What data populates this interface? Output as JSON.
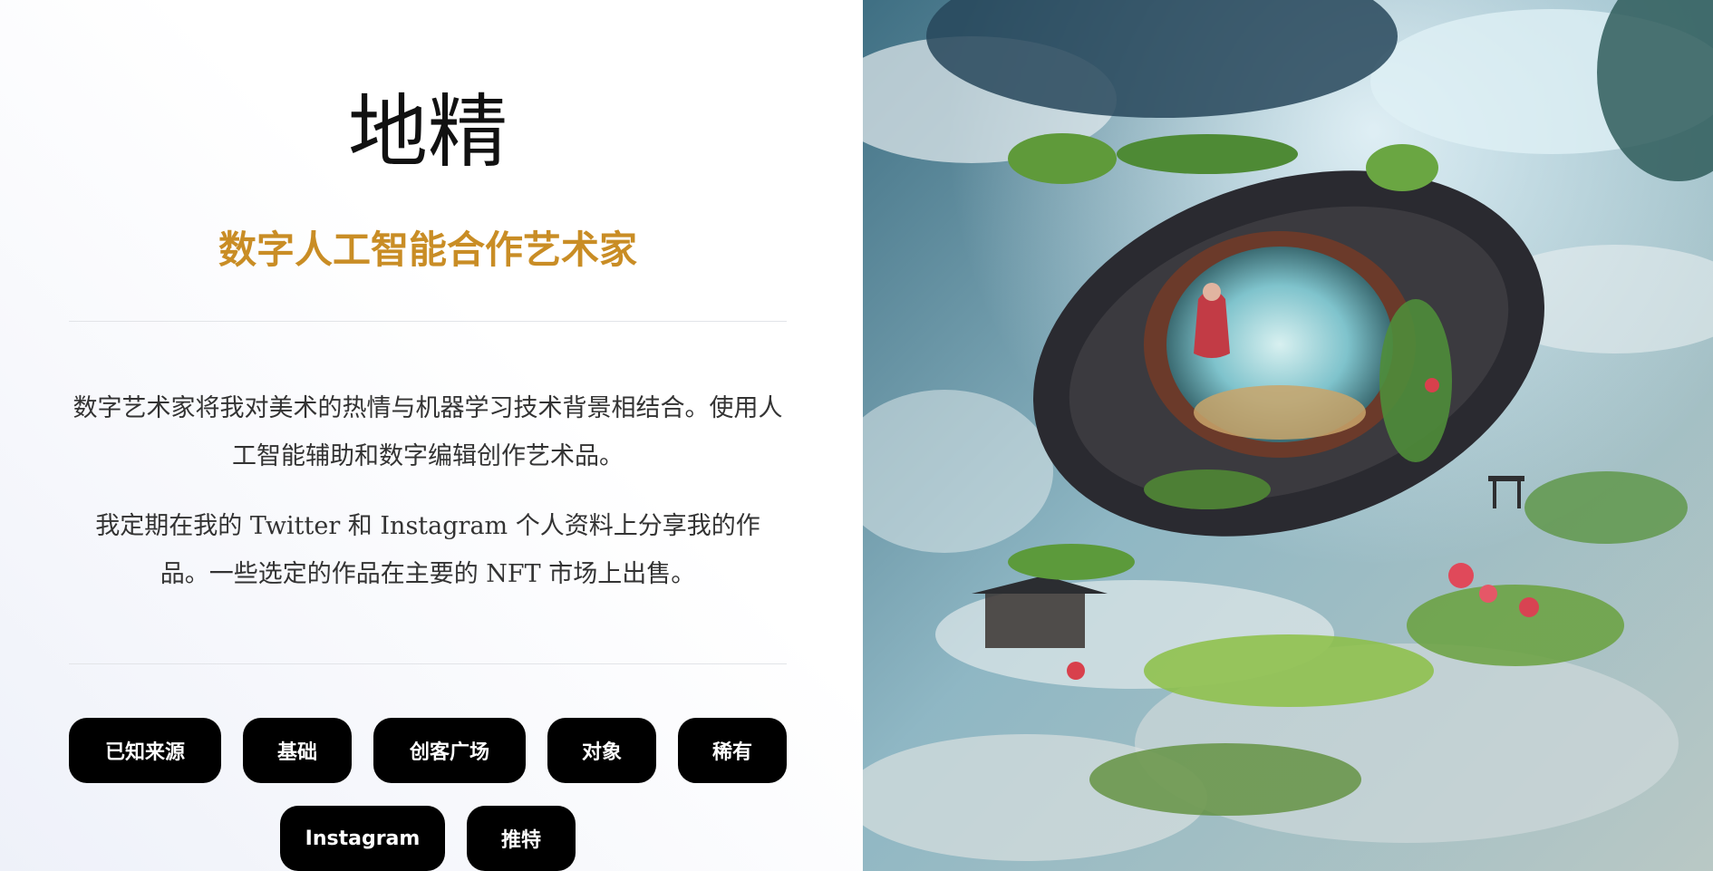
{
  "header": {
    "title": "地精",
    "subtitle": "数字人工智能合作艺术家"
  },
  "about": {
    "paragraph_1": "数字艺术家将我对美术的热情与机器学习技术背景相结合。使用人工智能辅助和数字编辑创作艺术品。",
    "paragraph_2": "我定期在我的 Twitter 和 Instagram 个人资料上分享我的作品。一些选定的作品在主要的 NFT 市场上出售。"
  },
  "links": [
    {
      "label": "已知来源"
    },
    {
      "label": "基础"
    },
    {
      "label": "创客广场"
    },
    {
      "label": "对象"
    },
    {
      "label": "稀有"
    },
    {
      "label": "Instagram"
    },
    {
      "label": "推特"
    }
  ],
  "colors": {
    "subtitle_gold": "#c98d25",
    "button_bg": "#000000",
    "button_text": "#ffffff"
  }
}
